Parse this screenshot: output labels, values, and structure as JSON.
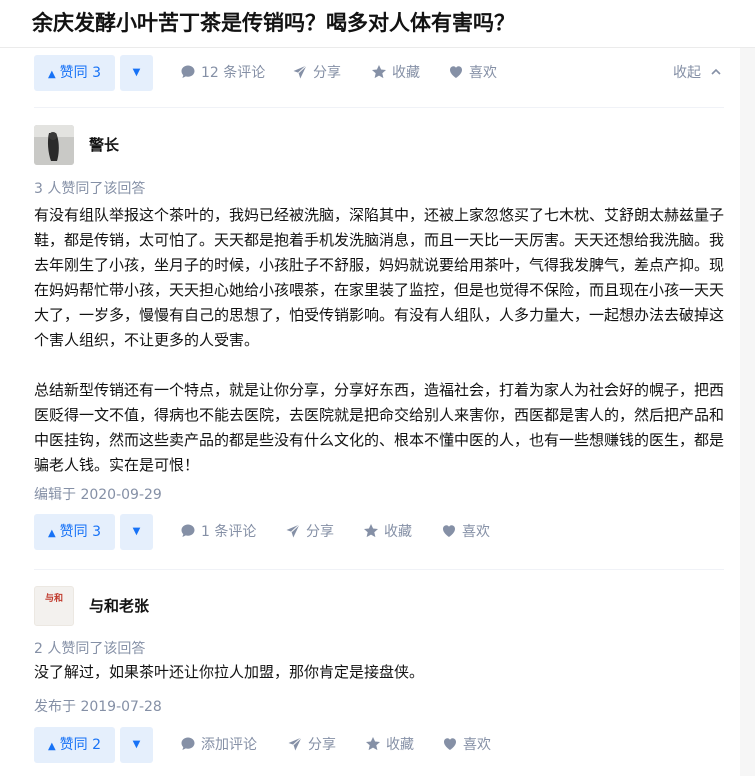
{
  "question": {
    "title": "余庆发酵小叶苦丁茶是传销吗？喝多对人体有害吗？"
  },
  "colors": {
    "accent": "#1772f6",
    "vote_bg": "#e5effc",
    "muted": "#8590a6"
  },
  "answers": [
    {
      "actions": {
        "vote_label": "赞同 3",
        "comment_label": "12 条评论",
        "share_label": "分享",
        "favorite_label": "收藏",
        "like_label": "喜欢",
        "collapse_label": "收起"
      }
    },
    {
      "author": "警长",
      "upvote_info": "3 人赞同了该回答",
      "paragraphs": [
        "有没有组队举报这个茶叶的，我妈已经被洗脑，深陷其中，还被上家忽悠买了七木枕、艾舒朗太赫兹量子鞋，都是传销，太可怕了。天天都是抱着手机发洗脑消息，而且一天比一天厉害。天天还想给我洗脑。我去年刚生了小孩，坐月子的时候，小孩肚子不舒服，妈妈就说要给用茶叶，气得我发脾气，差点产抑。现在妈妈帮忙带小孩，天天担心她给小孩喂茶，在家里装了监控，但是也觉得不保险，而且现在小孩一天天大了，一岁多，慢慢有自己的思想了，怕受传销影响。有没有人组队，人多力量大，一起想办法去破掉这个害人组织，不让更多的人受害。",
        "总结新型传销还有一个特点，就是让你分享，分享好东西，造福社会，打着为家人为社会好的幌子，把西医贬得一文不值，得病也不能去医院，去医院就是把命交给别人来害你，西医都是害人的，然后把产品和中医挂钩，然而这些卖产品的都是些没有什么文化的、根本不懂中医的人，也有一些想赚钱的医生，都是骗老人钱。实在是可恨！"
      ],
      "date": "编辑于 2020-09-29",
      "actions": {
        "vote_label": "赞同 3",
        "comment_label": "1 条评论",
        "share_label": "分享",
        "favorite_label": "收藏",
        "like_label": "喜欢"
      }
    },
    {
      "author": "与和老张",
      "avatar_text": "与和",
      "upvote_info": "2 人赞同了该回答",
      "paragraphs": [
        "没了解过，如果茶叶还让你拉人加盟，那你肯定是接盘侠。"
      ],
      "date": "发布于 2019-07-28",
      "actions": {
        "vote_label": "赞同 2",
        "comment_label": "添加评论",
        "share_label": "分享",
        "favorite_label": "收藏",
        "like_label": "喜欢"
      }
    }
  ]
}
